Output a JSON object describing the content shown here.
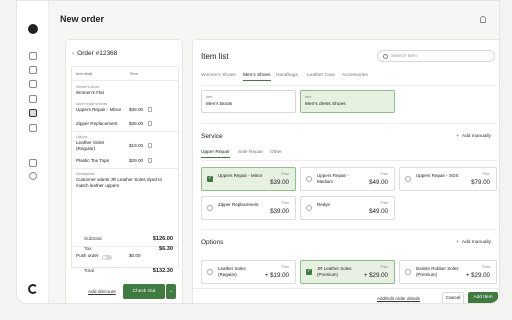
{
  "page": {
    "title": "New order"
  },
  "sidebar": {
    "icons": [
      "avatar",
      "home-icon",
      "document-icon",
      "checkbox-icon",
      "message-icon",
      "orders-icon",
      "users-icon",
      "link-icon",
      "settings-icon"
    ]
  },
  "order": {
    "number": "Order #12368",
    "columns": {
      "item": "Item detail",
      "price": "Price"
    },
    "shoe_label": "Women's shoes",
    "shoe_value": "Women's Flat",
    "upper_label": "Upper repair services",
    "upper_items": [
      {
        "name": "Uppers Repair - Minor",
        "price": "$39.00"
      },
      {
        "name": "Zipper Replacement",
        "price": "$39.00"
      }
    ],
    "options_label": "Options",
    "option_items": [
      {
        "name": "Leather Soles (Regular)",
        "price": "$19.00"
      },
      {
        "name": "Plastic Toe Tops",
        "price": "$29.00"
      }
    ],
    "desc_label": "Descriptions",
    "desc_text": "Customer wants JR Leather Soles dyed to match leather uppers",
    "push_order": "Push order",
    "push_price": "$0.00",
    "subtotal_label": "Subtotal",
    "subtotal": "$126.00",
    "tax_label": "Tax",
    "tax": "$6.30",
    "total_label": "Total",
    "total": "$132.30",
    "add_discount": "Add discount",
    "checkout": "Check Out"
  },
  "items": {
    "title": "Item list",
    "search_placeholder": "Search Item",
    "categories": [
      "Women's Shoes",
      "Men's Shoes",
      "Handbags",
      "Leather Care",
      "Accessories"
    ],
    "active_category": 1,
    "selectors": [
      {
        "label": "Item",
        "value": "Men's Boots",
        "active": false
      },
      {
        "label": "Item",
        "value": "Men's dress Shoes",
        "active": true
      }
    ],
    "service_title": "Service",
    "add_manually": "Add manually",
    "service_tabs": [
      "Upper Repair",
      "Sole Repair",
      "Other"
    ],
    "active_service_tab": 0,
    "price_label": "Price",
    "service_cards": [
      {
        "name": "Uppers Repair - Minor",
        "price": "$39.00",
        "checked": true
      },
      {
        "name": "Uppers Repair - Medium",
        "price": "$49.00",
        "checked": false
      },
      {
        "name": "Uppers Repair - SOS",
        "price": "$79.00",
        "checked": false
      },
      {
        "name": "Zipper Replacement",
        "price": "$39.00",
        "checked": false
      },
      {
        "name": "Redye",
        "price": "$49.00",
        "checked": false
      }
    ],
    "options_title": "Options",
    "option_cards": [
      {
        "name": "Leather Soles (Regular)",
        "price": "+ $19.00",
        "checked": false
      },
      {
        "name": "JR Leather Soles (Premium)",
        "price": "+ $29.00",
        "checked": true
      },
      {
        "name": "Dainite Rubber Soles (Premium)",
        "price": "+ $29.00",
        "checked": false
      }
    ],
    "add_details": "Add/Edit order details",
    "cancel": "Cancel",
    "add_item": "Add Item"
  },
  "colors": {
    "accent": "#3f7a3f",
    "accent_light": "#e6f1e2"
  }
}
